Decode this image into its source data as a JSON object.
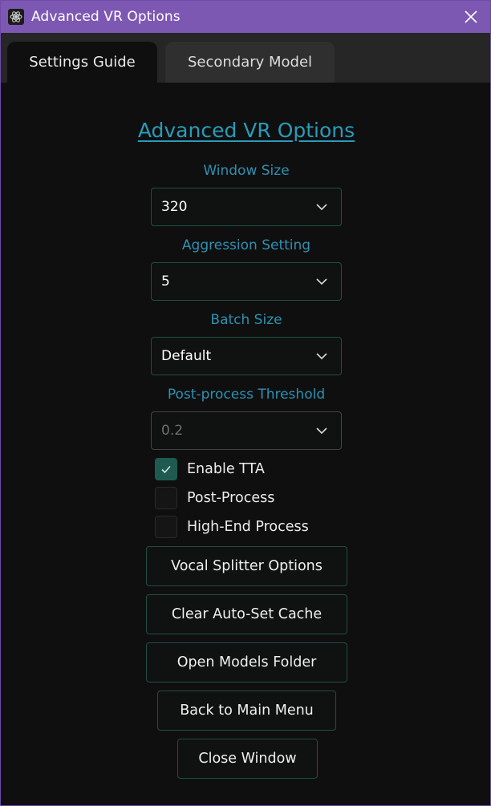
{
  "window": {
    "title": "Advanced VR Options",
    "title_bar_color": "#7d58b3"
  },
  "tabs": [
    {
      "label": "Settings Guide",
      "active": true
    },
    {
      "label": "Secondary Model",
      "active": false
    }
  ],
  "main": {
    "heading": "Advanced VR Options",
    "accent_color": "#2a9bb8",
    "fields": {
      "window_size": {
        "label": "Window Size",
        "value": "320"
      },
      "aggression_setting": {
        "label": "Aggression Setting",
        "value": "5"
      },
      "batch_size": {
        "label": "Batch Size",
        "value": "Default"
      },
      "post_process_threshold": {
        "label": "Post-process Threshold",
        "value": "0.2",
        "disabled": true
      }
    },
    "checkboxes": [
      {
        "label": "Enable TTA",
        "checked": true
      },
      {
        "label": "Post-Process",
        "checked": false
      },
      {
        "label": "High-End Process",
        "checked": false
      }
    ],
    "buttons": {
      "vocal_splitter": "Vocal Splitter Options",
      "clear_cache": "Clear Auto-Set Cache",
      "open_models": "Open Models Folder",
      "back_main": "Back to Main Menu",
      "close_window": "Close Window"
    }
  }
}
